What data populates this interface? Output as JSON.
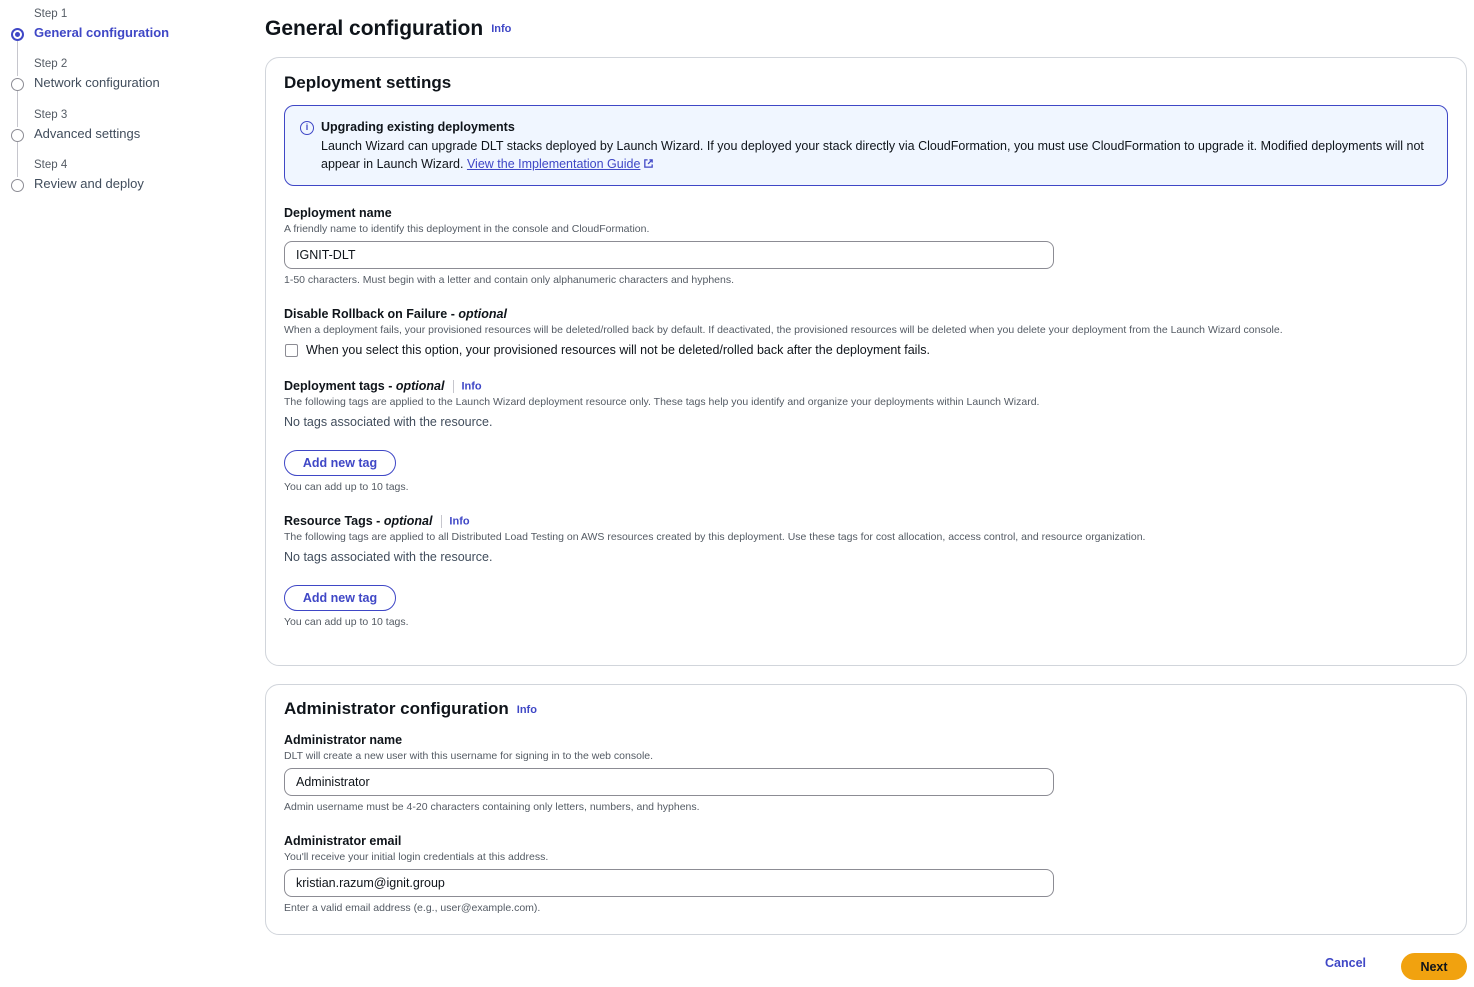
{
  "stepper": [
    {
      "num": "Step 1",
      "title": "General configuration",
      "active": true
    },
    {
      "num": "Step 2",
      "title": "Network configuration",
      "active": false
    },
    {
      "num": "Step 3",
      "title": "Advanced settings",
      "active": false
    },
    {
      "num": "Step 4",
      "title": "Review and deploy",
      "active": false
    }
  ],
  "page": {
    "title": "General configuration",
    "info": "Info"
  },
  "deployment_settings": {
    "title": "Deployment settings",
    "alert": {
      "title": "Upgrading existing deployments",
      "body": "Launch Wizard can upgrade DLT stacks deployed by Launch Wizard. If you deployed your stack directly via CloudFormation, you must use CloudFormation to upgrade it. Modified deployments will not appear in Launch Wizard.",
      "link": "View the Implementation Guide"
    },
    "deployment_name": {
      "label": "Deployment name",
      "description": "A friendly name to identify this deployment in the console and CloudFormation.",
      "value": "IGNIT-DLT",
      "constraint": "1-50 characters. Must begin with a letter and contain only alphanumeric characters and hyphens."
    },
    "rollback": {
      "label": "Disable Rollback on Failure",
      "optional": "optional",
      "description": "When a deployment fails, your provisioned resources will be deleted/rolled back by default. If deactivated, the provisioned resources will be deleted when you delete your deployment from the Launch Wizard console.",
      "checkbox_label": "When you select this option, your provisioned resources will not be deleted/rolled back after the deployment fails."
    },
    "deployment_tags": {
      "label": "Deployment tags",
      "optional": "optional",
      "info": "Info",
      "description": "The following tags are applied to the Launch Wizard deployment resource only. These tags help you identify and organize your deployments within Launch Wizard.",
      "empty": "No tags associated with the resource.",
      "button": "Add new tag",
      "hint": "You can add up to 10 tags."
    },
    "resource_tags": {
      "label": "Resource Tags",
      "optional": "optional",
      "info": "Info",
      "description": "The following tags are applied to all Distributed Load Testing on AWS resources created by this deployment. Use these tags for cost allocation, access control, and resource organization.",
      "empty": "No tags associated with the resource.",
      "button": "Add new tag",
      "hint": "You can add up to 10 tags."
    }
  },
  "admin_config": {
    "title": "Administrator configuration",
    "info": "Info",
    "admin_name": {
      "label": "Administrator name",
      "description": "DLT will create a new user with this username for signing in to the web console.",
      "value": "Administrator",
      "constraint": "Admin username must be 4-20 characters containing only letters, numbers, and hyphens."
    },
    "admin_email": {
      "label": "Administrator email",
      "description": "You'll receive your initial login credentials at this address.",
      "value": "kristian.razum@ignit.group",
      "constraint": "Enter a valid email address (e.g., user@example.com)."
    }
  },
  "footer": {
    "cancel": "Cancel",
    "next": "Next"
  },
  "colors": {
    "accent": "#3f47c6",
    "primary_button": "#f1a20f",
    "alert_bg": "#f0f6ff"
  }
}
